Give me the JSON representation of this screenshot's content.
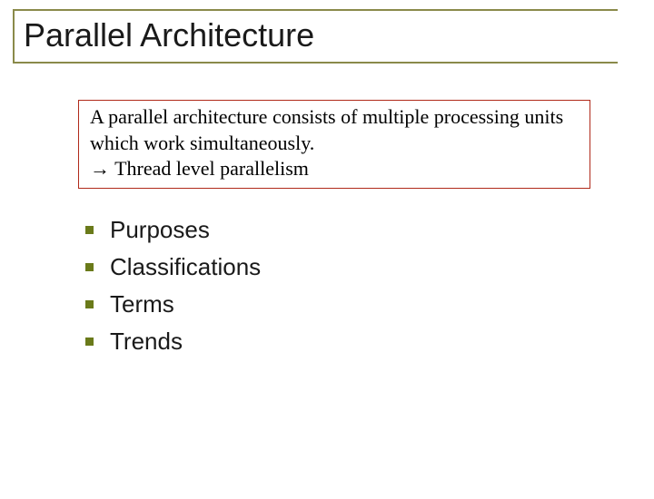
{
  "title": "Parallel Architecture",
  "definition": {
    "line1": "A parallel architecture consists of multiple processing units which work simultaneously.",
    "line2": "→   Thread level parallelism"
  },
  "bullets": {
    "b0": "Purposes",
    "b1": "Classifications",
    "b2": "Terms",
    "b3": "Trends"
  }
}
